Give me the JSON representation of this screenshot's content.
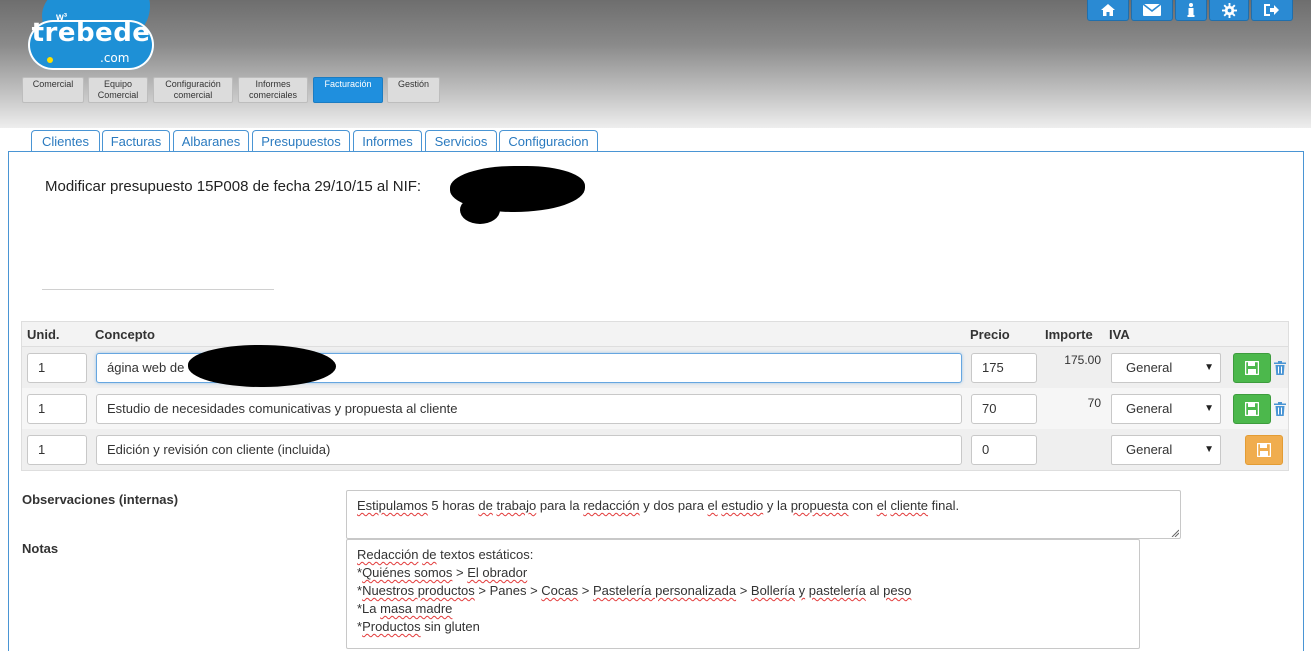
{
  "logo": {
    "superscript": "w³",
    "name": "trebede",
    "domain": ".com"
  },
  "top_icons": [
    "home-icon",
    "envelope-icon",
    "info-icon",
    "gear-icon",
    "logout-icon"
  ],
  "modules": [
    {
      "line1": "Comercial",
      "line2": ""
    },
    {
      "line1": "Equipo",
      "line2": "Comercial"
    },
    {
      "line1": "Configuración",
      "line2": "comercial"
    },
    {
      "line1": "Informes",
      "line2": "comerciales"
    },
    {
      "line1": "Facturación",
      "line2": ""
    },
    {
      "line1": "Gestión",
      "line2": ""
    }
  ],
  "tabs": [
    "Clientes",
    "Facturas",
    "Albaranes",
    "Presupuestos",
    "Informes",
    "Servicios",
    "Configuracion"
  ],
  "page": {
    "title": "Modificar presupuesto 15P008 de fecha 29/10/15 al NIF:"
  },
  "table": {
    "headers": {
      "unid": "Unid.",
      "concepto": "Concepto",
      "precio": "Precio",
      "importe": "Importe",
      "iva": "IVA"
    },
    "rows": [
      {
        "unid": "1",
        "concepto": "ágina web de",
        "precio": "175",
        "importe": "175.00",
        "iva": "General"
      },
      {
        "unid": "1",
        "concepto": "Estudio de necesidades comunicativas y propuesta al cliente",
        "precio": "70",
        "importe": "70",
        "iva": "General"
      },
      {
        "unid": "1",
        "concepto": "Edición y revisión con cliente (incluida)",
        "precio": "0",
        "importe": "",
        "iva": "General"
      }
    ]
  },
  "observaciones": {
    "label": "Observaciones (internas)",
    "text_parts": [
      "Estipulamos",
      " 5 horas ",
      "de",
      " ",
      "trabajo",
      " para la ",
      "redacción",
      " y dos para ",
      "el",
      " ",
      "estudio",
      " y la ",
      "propuesta",
      " con ",
      "el",
      " ",
      "cliente",
      " final."
    ]
  },
  "notas": {
    "label": "Notas",
    "lines": [
      [
        "Redacción",
        " ",
        "de",
        " ",
        "textos estáticos",
        ":"
      ],
      [
        "*",
        "Quiénes somos",
        " > ",
        "El obrador",
        ""
      ],
      [
        "*",
        "Nuestros productos",
        " > Panes > ",
        "Cocas",
        " > ",
        "Pastelería personalizada",
        " > ",
        "Bollería",
        " ",
        "y",
        " ",
        "pastelería",
        " al ",
        "peso"
      ],
      [
        "*La ",
        "masa madre",
        ""
      ],
      [
        "*",
        "Productos",
        " sin gluten"
      ]
    ]
  },
  "colors": {
    "brand_blue": "#1e90d6",
    "tab_blue": "#2a7abf",
    "active_module": "#1f8fde",
    "save_green": "#4cb84c",
    "save_orange": "#f0ad4e"
  }
}
